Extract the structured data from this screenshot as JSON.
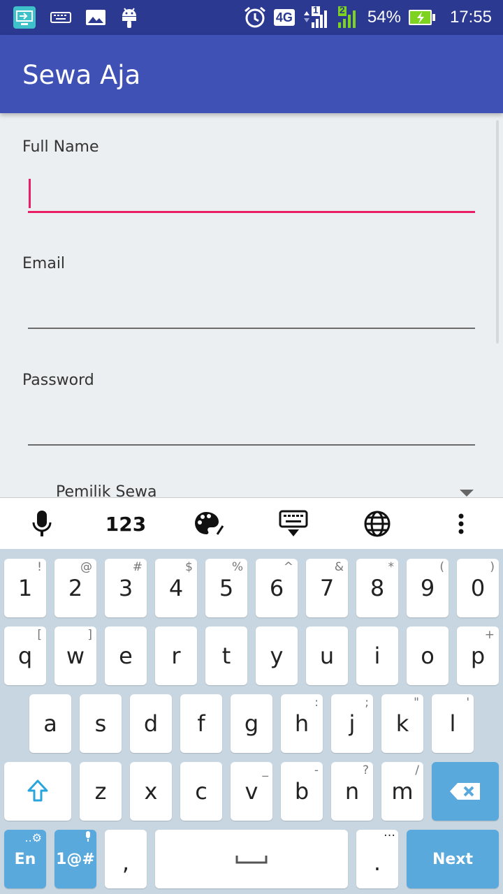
{
  "status": {
    "battery": "54%",
    "time": "17:55",
    "network": "4G",
    "sim1": "1",
    "sim2": "2"
  },
  "app": {
    "title": "Sewa Aja"
  },
  "form": {
    "full_name_label": "Full Name",
    "full_name_value": "",
    "email_label": "Email",
    "email_value": "",
    "password_label": "Password",
    "password_value": "",
    "role_selected": "Pemilik Sewa"
  },
  "keyboard": {
    "toolbar": {
      "numbers_label": "123"
    },
    "rows": [
      [
        {
          "k": "1",
          "s": "!"
        },
        {
          "k": "2",
          "s": "@"
        },
        {
          "k": "3",
          "s": "#"
        },
        {
          "k": "4",
          "s": "$"
        },
        {
          "k": "5",
          "s": "%"
        },
        {
          "k": "6",
          "s": "^"
        },
        {
          "k": "7",
          "s": "&"
        },
        {
          "k": "8",
          "s": "*"
        },
        {
          "k": "9",
          "s": "("
        },
        {
          "k": "0",
          "s": ")"
        }
      ],
      [
        {
          "k": "q",
          "s": "["
        },
        {
          "k": "w",
          "s": "]"
        },
        {
          "k": "e",
          "s": ""
        },
        {
          "k": "r",
          "s": ""
        },
        {
          "k": "t",
          "s": ""
        },
        {
          "k": "y",
          "s": ""
        },
        {
          "k": "u",
          "s": ""
        },
        {
          "k": "i",
          "s": ""
        },
        {
          "k": "o",
          "s": ""
        },
        {
          "k": "p",
          "s": "+"
        }
      ],
      [
        {
          "k": "a",
          "s": ""
        },
        {
          "k": "s",
          "s": ""
        },
        {
          "k": "d",
          "s": ""
        },
        {
          "k": "f",
          "s": ""
        },
        {
          "k": "g",
          "s": ""
        },
        {
          "k": "h",
          "s": ":"
        },
        {
          "k": "j",
          "s": ";"
        },
        {
          "k": "k",
          "s": "\""
        },
        {
          "k": "l",
          "s": "'"
        }
      ],
      [
        {
          "k": "z",
          "s": ""
        },
        {
          "k": "x",
          "s": ""
        },
        {
          "k": "c",
          "s": ""
        },
        {
          "k": "v",
          "s": "_"
        },
        {
          "k": "b",
          "s": "-"
        },
        {
          "k": "n",
          "s": "?"
        },
        {
          "k": "m",
          "s": "/"
        }
      ]
    ],
    "lang_label": "En",
    "symbols_label": "1@#",
    "comma": ",",
    "period": ".",
    "next_label": "Next"
  },
  "colors": {
    "statusbar": "#2b3990",
    "appbar": "#3f51b5",
    "accent": "#e91e63",
    "keyboard_bg": "#c7d6e0",
    "keyboard_blue": "#5aa9dd"
  },
  "icons": [
    "screen-cast-icon",
    "keyboard-icon",
    "image-icon",
    "android-icon",
    "alarm-icon",
    "signal-icon",
    "battery-charging-icon",
    "microphone-icon",
    "palette-icon",
    "hide-keyboard-icon",
    "globe-icon",
    "more-vert-icon",
    "shift-icon",
    "backspace-icon",
    "space-icon"
  ]
}
